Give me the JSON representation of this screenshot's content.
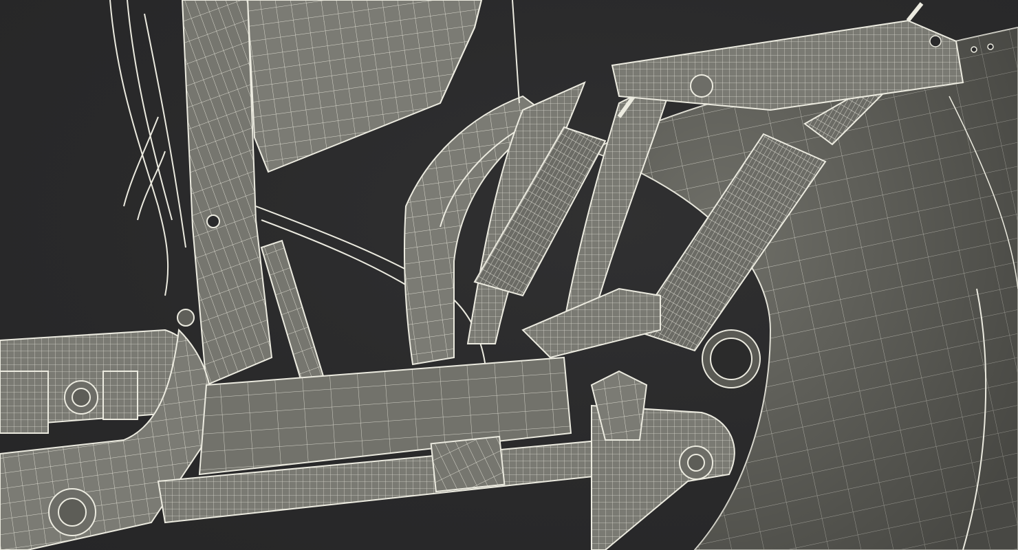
{
  "scene": {
    "subject": "wireframe-mechanical-assembly",
    "background_color": "#2a2a2b",
    "surface_color": "#7d7d76",
    "surface_dark": "#5f5f59",
    "wire_color": "#e9e7dc"
  }
}
